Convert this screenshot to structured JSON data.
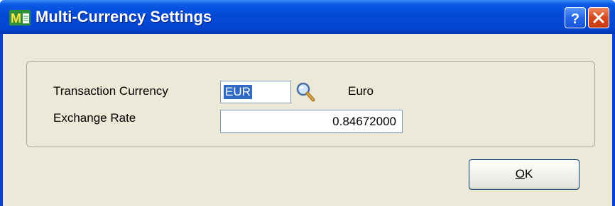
{
  "window": {
    "title": "Multi-Currency Settings",
    "app_icon": "mas-app-icon",
    "help_icon": "help-icon",
    "close_icon": "close-icon"
  },
  "form": {
    "transaction_currency_label": "Transaction Currency",
    "transaction_currency_value": "EUR",
    "currency_description": "Euro",
    "lookup_icon": "magnifier-lookup-icon",
    "exchange_rate_label": "Exchange Rate",
    "exchange_rate_value": "0.84672000"
  },
  "buttons": {
    "ok_mnemonic": "O",
    "ok_rest": "K"
  },
  "colors": {
    "titlebar": "#0446d2",
    "dialog_bg": "#ece9d8",
    "selection": "#316ac5",
    "close_button": "#d44a1e",
    "help_button": "#2566ec"
  }
}
